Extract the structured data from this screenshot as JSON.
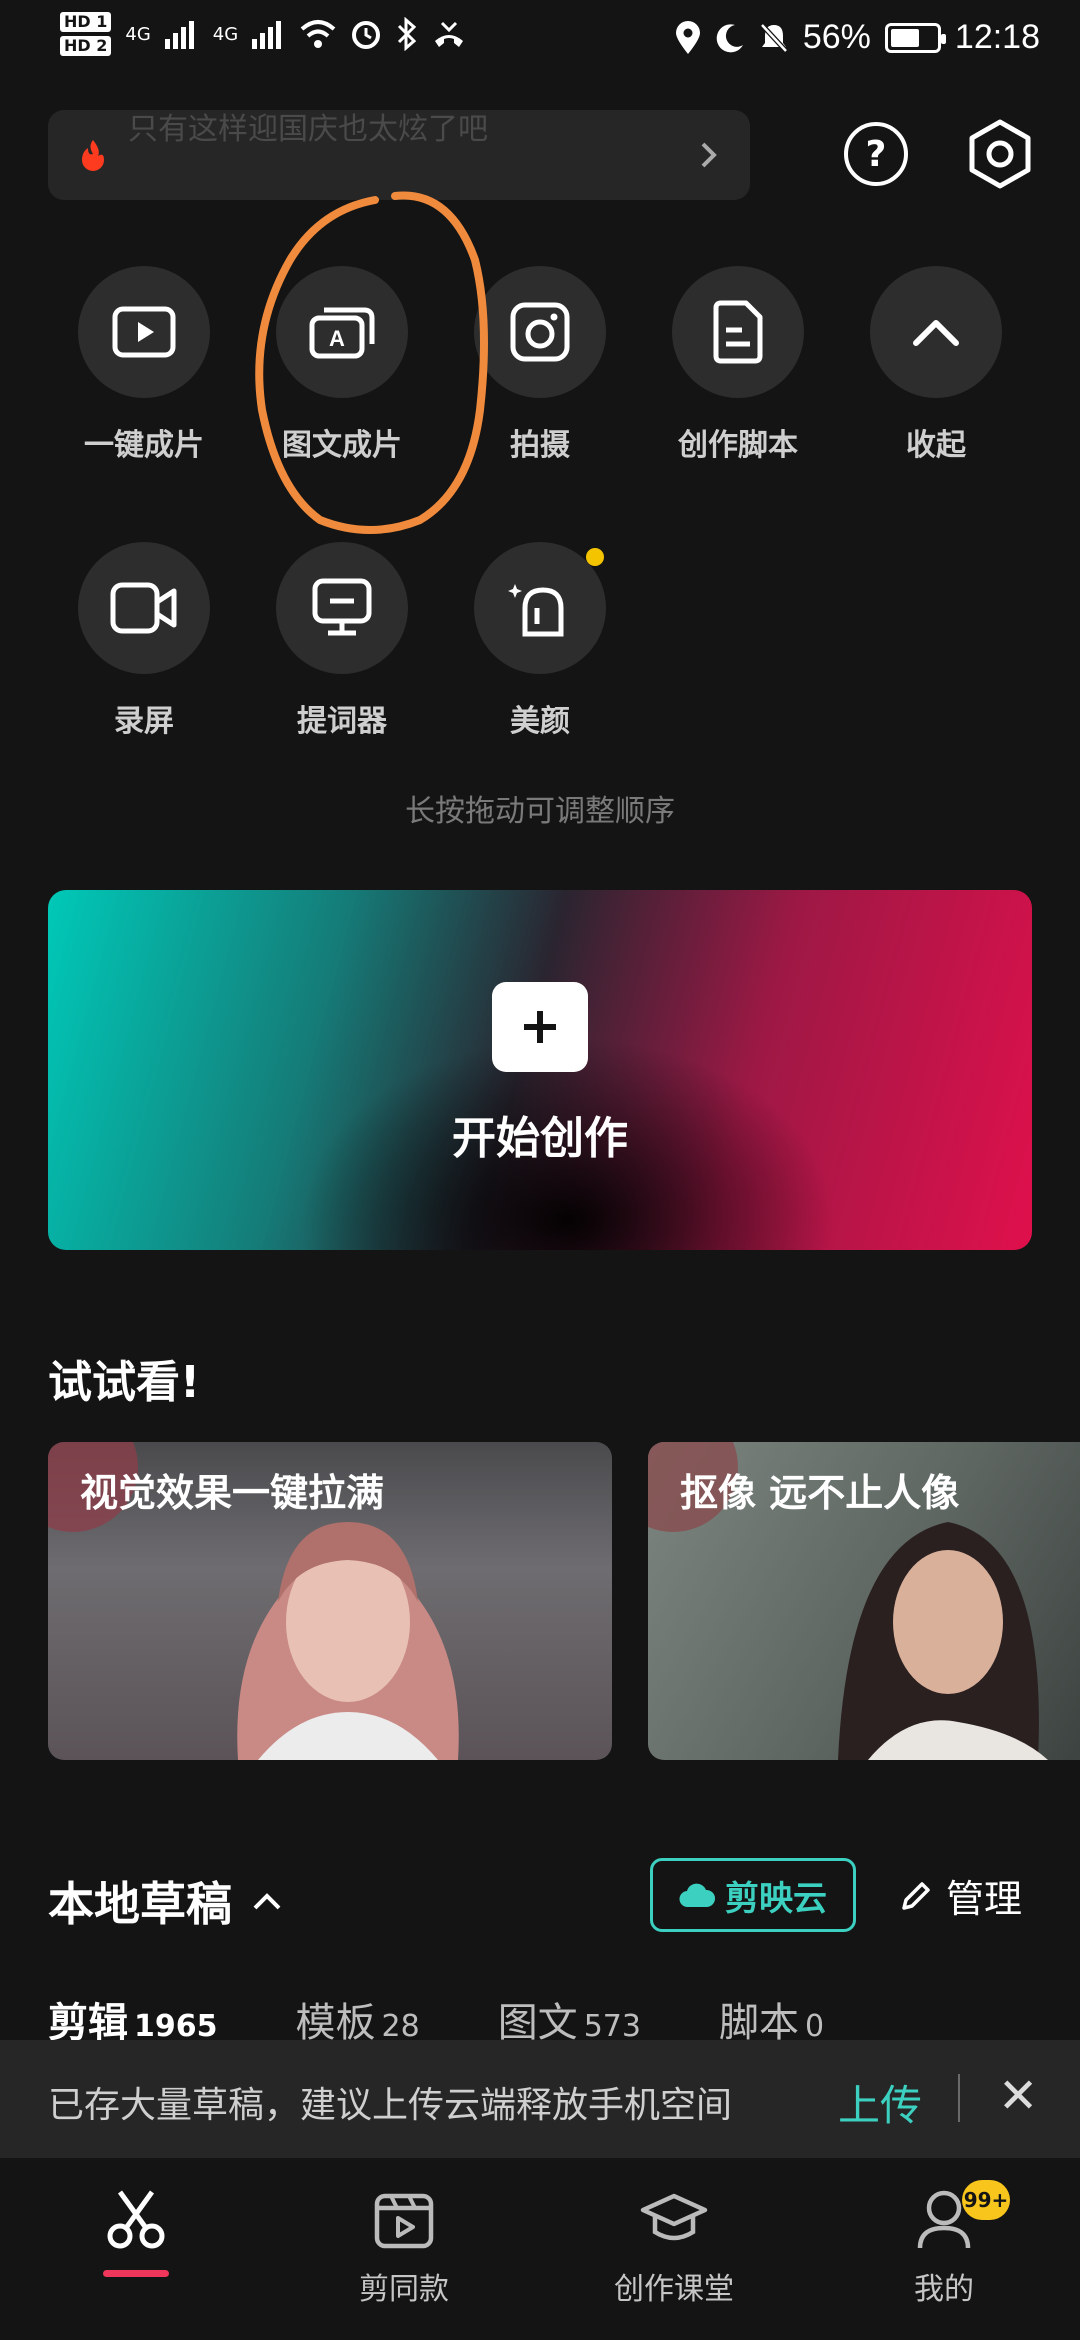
{
  "status_bar": {
    "hd1": "HD 1",
    "hd2": "HD 2",
    "network1": "4G",
    "network2": "4G",
    "battery_percent": "56%",
    "battery_level": 0.56,
    "time": "12:18"
  },
  "hot_search": {
    "text": "只有这样迎国庆也太炫了吧"
  },
  "tools": [
    {
      "label": "一键成片",
      "icon": "play-video-icon"
    },
    {
      "label": "图文成片",
      "icon": "text-to-video-icon"
    },
    {
      "label": "拍摄",
      "icon": "camera-icon"
    },
    {
      "label": "创作脚本",
      "icon": "script-icon"
    },
    {
      "label": "收起",
      "icon": "chevron-up-icon"
    },
    {
      "label": "录屏",
      "icon": "screen-record-icon"
    },
    {
      "label": "提词器",
      "icon": "teleprompter-icon"
    },
    {
      "label": "美颜",
      "icon": "beauty-icon"
    }
  ],
  "hint": "长按拖动可调整顺序",
  "banner": {
    "label": "开始创作"
  },
  "try_section": {
    "title": "试试看!",
    "cards": [
      {
        "title": "视觉效果一键拉满"
      },
      {
        "title": "抠像 远不止人像"
      }
    ]
  },
  "drafts": {
    "title": "本地草稿",
    "cloud_label": "剪映云",
    "manage_label": "管理",
    "tabs": [
      {
        "label": "剪辑",
        "count": "1965",
        "active": true
      },
      {
        "label": "模板",
        "count": "28",
        "active": false
      },
      {
        "label": "图文",
        "count": "573",
        "active": false
      },
      {
        "label": "脚本",
        "count": "0",
        "active": false
      }
    ]
  },
  "notice": {
    "text": "已存大量草稿，建议上传云端释放手机空间",
    "upload_label": "上传"
  },
  "bottom_nav": {
    "items": [
      {
        "label": "",
        "icon": "scissors-icon",
        "active": true
      },
      {
        "label": "剪同款",
        "icon": "template-play-icon",
        "active": false
      },
      {
        "label": "创作课堂",
        "icon": "graduation-cap-icon",
        "active": false
      },
      {
        "label": "我的",
        "icon": "profile-icon",
        "active": false,
        "badge": "99+"
      }
    ]
  },
  "colors": {
    "background": "#141414",
    "accent_teal": "#3cd0c0",
    "accent_red": "#f0375b",
    "annotation_orange": "#f08a3c"
  }
}
